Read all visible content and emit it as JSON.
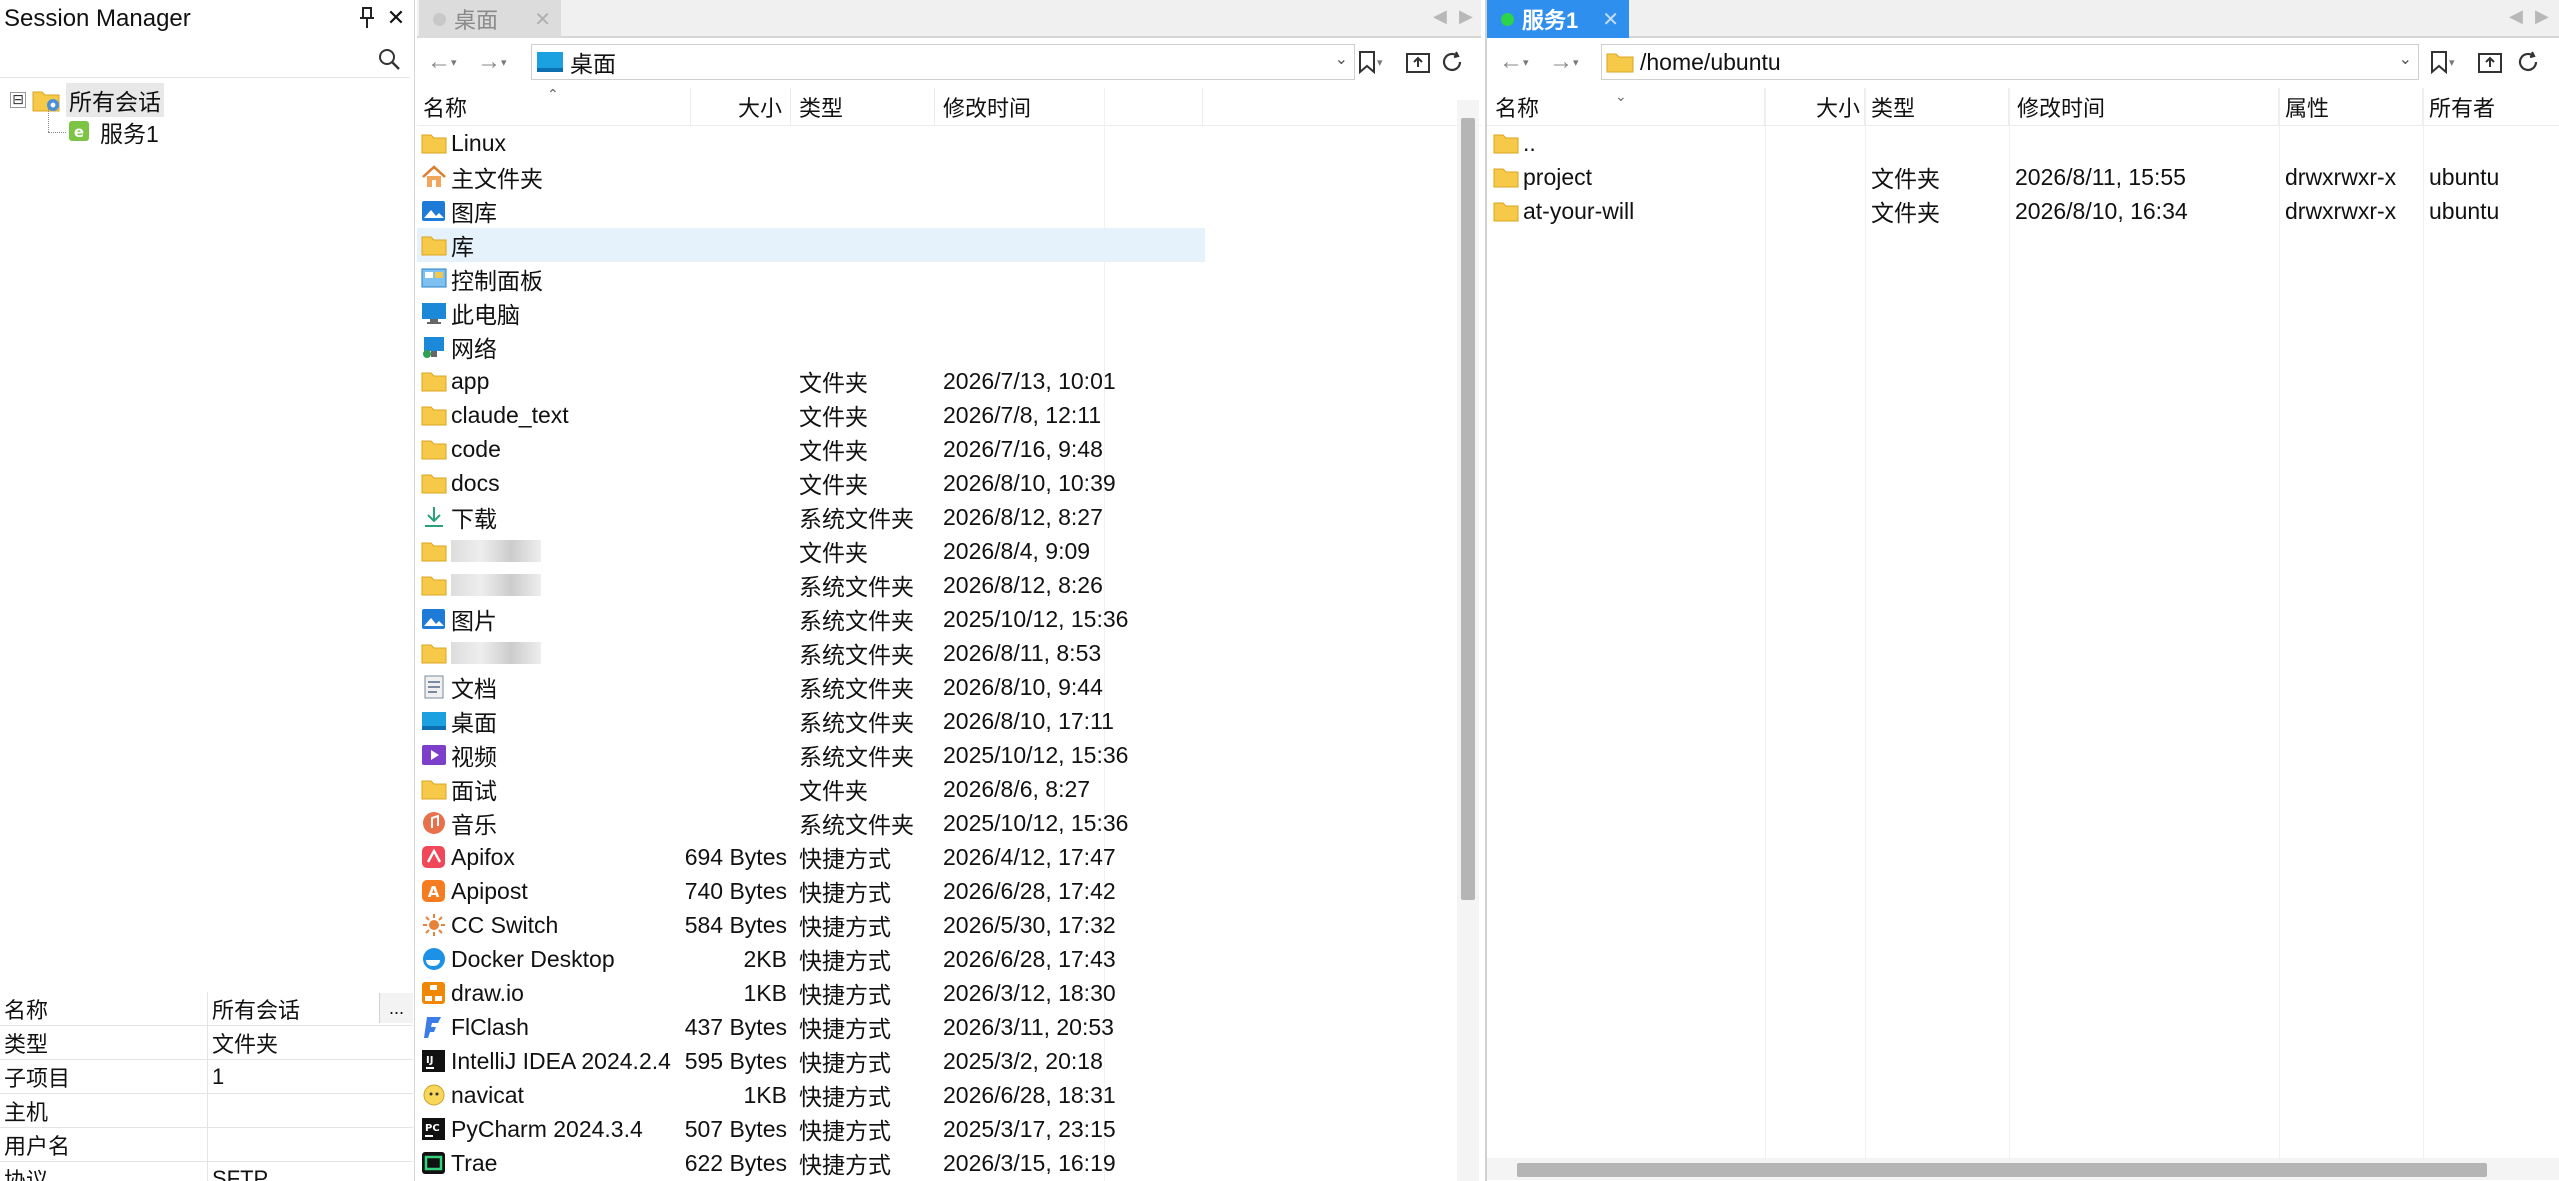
{
  "session": {
    "title": "Session Manager",
    "search_placeholder": "",
    "tree": {
      "root_label": "所有会话",
      "expander": "⊟",
      "child_label": "服务1"
    },
    "properties": [
      {
        "key": "名称",
        "value": "所有会话"
      },
      {
        "key": "类型",
        "value": "文件夹"
      },
      {
        "key": "子项目",
        "value": "1"
      },
      {
        "key": "主机",
        "value": ""
      },
      {
        "key": "用户名",
        "value": ""
      },
      {
        "key": "协议",
        "value": "SFTP"
      }
    ],
    "ellipsis_label": "..."
  },
  "local": {
    "tab_label": "桌面",
    "path": "桌面",
    "headers": {
      "name": "名称",
      "size": "大小",
      "type": "类型",
      "modified": "修改时间"
    },
    "rows": [
      {
        "name": "Linux",
        "size": "",
        "type": "",
        "modified": "",
        "icon": "folder-icon"
      },
      {
        "name": "主文件夹",
        "size": "",
        "type": "",
        "modified": "",
        "icon": "home-icon"
      },
      {
        "name": "图库",
        "size": "",
        "type": "",
        "modified": "",
        "icon": "gallery-icon"
      },
      {
        "name": "库",
        "size": "",
        "type": "",
        "modified": "",
        "icon": "folder-icon"
      },
      {
        "name": "控制面板",
        "size": "",
        "type": "",
        "modified": "",
        "icon": "control-panel-icon"
      },
      {
        "name": "此电脑",
        "size": "",
        "type": "",
        "modified": "",
        "icon": "computer-icon"
      },
      {
        "name": "网络",
        "size": "",
        "type": "",
        "modified": "",
        "icon": "network-icon"
      },
      {
        "name": "app",
        "size": "",
        "type": "文件夹",
        "modified": "2026/7/13, 10:01",
        "icon": "folder-icon"
      },
      {
        "name": "claude_text",
        "size": "",
        "type": "文件夹",
        "modified": "2026/7/8, 12:11",
        "icon": "folder-icon"
      },
      {
        "name": "code",
        "size": "",
        "type": "文件夹",
        "modified": "2026/7/16, 9:48",
        "icon": "folder-icon"
      },
      {
        "name": "docs",
        "size": "",
        "type": "文件夹",
        "modified": "2026/8/10, 10:39",
        "icon": "folder-icon"
      },
      {
        "name": "下载",
        "size": "",
        "type": "系统文件夹",
        "modified": "2026/8/12, 8:27",
        "icon": "download-icon"
      },
      {
        "name": "",
        "size": "",
        "type": "文件夹",
        "modified": "2026/8/4, 9:09",
        "icon": "folder-icon",
        "blurred": true
      },
      {
        "name": "",
        "size": "",
        "type": "系统文件夹",
        "modified": "2026/8/12, 8:26",
        "icon": "folder-icon",
        "blurred": true
      },
      {
        "name": "图片",
        "size": "",
        "type": "系统文件夹",
        "modified": "2025/10/12, 15:36",
        "icon": "pictures-icon"
      },
      {
        "name": "",
        "size": "",
        "type": "系统文件夹",
        "modified": "2026/8/11, 8:53",
        "icon": "folder-icon",
        "blurred": true
      },
      {
        "name": "文档",
        "size": "",
        "type": "系统文件夹",
        "modified": "2026/8/10, 9:44",
        "icon": "documents-icon"
      },
      {
        "name": "桌面",
        "size": "",
        "type": "系统文件夹",
        "modified": "2026/8/10, 17:11",
        "icon": "desktop-icon"
      },
      {
        "name": "视频",
        "size": "",
        "type": "系统文件夹",
        "modified": "2025/10/12, 15:36",
        "icon": "videos-icon"
      },
      {
        "name": "面试",
        "size": "",
        "type": "文件夹",
        "modified": "2026/8/6, 8:27",
        "icon": "folder-icon"
      },
      {
        "name": "音乐",
        "size": "",
        "type": "系统文件夹",
        "modified": "2025/10/12, 15:36",
        "icon": "music-icon"
      },
      {
        "name": "Apifox",
        "size": "694 Bytes",
        "type": "快捷方式",
        "modified": "2026/4/12, 17:47",
        "icon": "apifox-icon"
      },
      {
        "name": "Apipost",
        "size": "740 Bytes",
        "type": "快捷方式",
        "modified": "2026/6/28, 17:42",
        "icon": "apipost-icon"
      },
      {
        "name": "CC Switch",
        "size": "584 Bytes",
        "type": "快捷方式",
        "modified": "2026/5/30, 17:32",
        "icon": "cc-switch-icon"
      },
      {
        "name": "Docker Desktop",
        "size": "2KB",
        "type": "快捷方式",
        "modified": "2026/6/28, 17:43",
        "icon": "docker-icon"
      },
      {
        "name": "draw.io",
        "size": "1KB",
        "type": "快捷方式",
        "modified": "2026/3/12, 18:30",
        "icon": "drawio-icon"
      },
      {
        "name": "FlClash",
        "size": "437 Bytes",
        "type": "快捷方式",
        "modified": "2026/3/11, 20:53",
        "icon": "flclash-icon"
      },
      {
        "name": "IntelliJ IDEA 2024.2.4",
        "size": "595 Bytes",
        "type": "快捷方式",
        "modified": "2025/3/2, 20:18",
        "icon": "intellij-icon"
      },
      {
        "name": "navicat",
        "size": "1KB",
        "type": "快捷方式",
        "modified": "2026/6/28, 18:31",
        "icon": "navicat-icon"
      },
      {
        "name": "PyCharm 2024.3.4",
        "size": "507 Bytes",
        "type": "快捷方式",
        "modified": "2025/3/17, 23:15",
        "icon": "pycharm-icon"
      },
      {
        "name": "Trae",
        "size": "622 Bytes",
        "type": "快捷方式",
        "modified": "2026/3/15, 16:19",
        "icon": "trae-icon"
      }
    ]
  },
  "remote": {
    "tab_label": "服务1",
    "path": "/home/ubuntu",
    "headers": {
      "name": "名称",
      "size": "大小",
      "type": "类型",
      "modified": "修改时间",
      "attrs": "属性",
      "owner": "所有者"
    },
    "rows": [
      {
        "name": "..",
        "size": "",
        "type": "",
        "modified": "",
        "attrs": "",
        "owner": "",
        "icon": "parent-folder-icon"
      },
      {
        "name": "project",
        "size": "",
        "type": "文件夹",
        "modified": "2026/8/11, 15:55",
        "attrs": "drwxrwxr-x",
        "owner": "ubuntu",
        "icon": "folder-icon"
      },
      {
        "name": "at-your-will",
        "size": "",
        "type": "文件夹",
        "modified": "2026/8/10, 16:34",
        "attrs": "drwxrwxr-x",
        "owner": "ubuntu",
        "icon": "folder-icon"
      }
    ]
  },
  "colors": {
    "accent": "#2f8fef",
    "folder": "#f7c948",
    "selected_row": "#e5f1fb",
    "connected": "#2bd44a",
    "disconnected": "#c8c8c8"
  }
}
